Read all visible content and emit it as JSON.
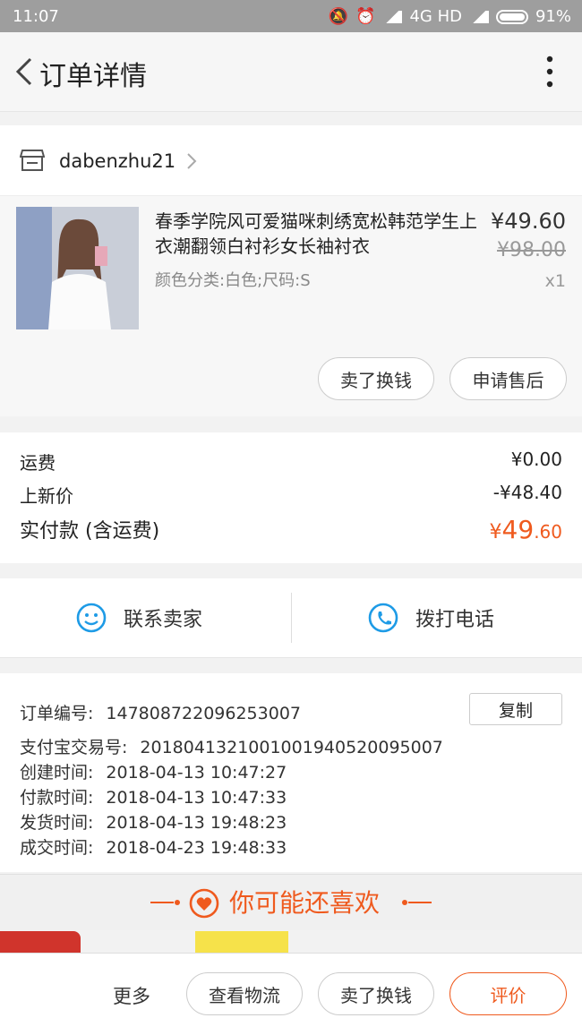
{
  "status_bar": {
    "time": "11:07",
    "network": "4G HD",
    "battery": "91%"
  },
  "nav": {
    "title": "订单详情"
  },
  "shop": {
    "name": "dabenzhu21"
  },
  "product": {
    "title": "春季学院风可爱猫咪刺绣宽松韩范学生上衣潮翻领白衬衫女长袖衬衣",
    "spec": "颜色分类:白色;尺码:S",
    "price": "¥49.60",
    "original_price": "¥98.00",
    "quantity": "x1",
    "actions": {
      "sell": "卖了换钱",
      "after_sale": "申请售后"
    }
  },
  "fees": {
    "shipping_label": "运费",
    "shipping_value": "¥0.00",
    "discount_label": "上新价",
    "discount_value": "-¥48.40",
    "paid_label": "实付款 (含运费)",
    "paid_currency": "¥",
    "paid_int": "49",
    "paid_dec": ".60"
  },
  "contact": {
    "seller": "联系卖家",
    "call": "拨打电话"
  },
  "order_info": {
    "order_no_label": "订单编号:",
    "order_no": "147808722096253007",
    "copy": "复制",
    "alipay_label": "支付宝交易号:",
    "alipay_no": "2018041321001001940520095007",
    "created_label": "创建时间:",
    "created": "2018-04-13 10:47:27",
    "paid_label": "付款时间:",
    "paid": "2018-04-13 10:47:33",
    "shipped_label": "发货时间:",
    "shipped": "2018-04-13 19:48:23",
    "completed_label": "成交时间:",
    "completed": "2018-04-23 19:48:33"
  },
  "recommend": {
    "title": "你可能还喜欢"
  },
  "bottom_bar": {
    "more": "更多",
    "logistics": "查看物流",
    "sell": "卖了换钱",
    "review": "评价"
  },
  "colors": {
    "accent": "#ef5a1e",
    "blue": "#1e9be6"
  }
}
